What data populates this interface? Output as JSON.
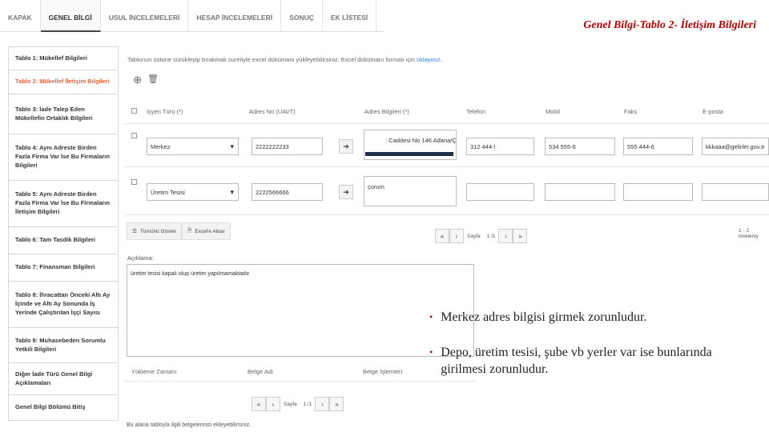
{
  "tabs": [
    {
      "label": "KAPAK"
    },
    {
      "label": "GENEL BİLGİ"
    },
    {
      "label": "USUL İNCELEMELERİ"
    },
    {
      "label": "HESAP İNCELEMELERİ"
    },
    {
      "label": "SONUÇ"
    },
    {
      "label": "EK LİSTESİ"
    }
  ],
  "slide_title": "Genel Bilgi-Tablo 2- İletişim Bilgileri",
  "sidebar": {
    "items": [
      {
        "label": "Tablo 1: Mükellef Bilgileri"
      },
      {
        "label": "Tablo 2: Mükellef İletişim Bilgileri"
      },
      {
        "label": "Tablo 3: İade Talep Eden Mükellefin Ortaklık Bilgileri"
      },
      {
        "label": "Tablo 4: Aynı Adreste Birden Fazla Firma Var İse Bu Firmaların Bilgileri"
      },
      {
        "label": "Tablo 5: Aynı Adreste Birden Fazla Firma Var İse Bu Firmaların İletişim Bilgileri"
      },
      {
        "label": "Tablo 6: Tam Tasdik Bilgileri"
      },
      {
        "label": "Tablo 7: Finansman Bilgileri"
      },
      {
        "label": "Tablo 8: İhracattan Önceki Altı Ay İçinde ve Altı Ay Sonunda İş Yerinde Çalıştırılan İşçi Sayısı"
      },
      {
        "label": "Tablo 9: Muhasebeden Sorumlu Yetkili Bilgileri"
      },
      {
        "label": "Diğer İade Türü Genel Bilgi Açıklamaları"
      },
      {
        "label": "Genel Bilgi Bölümü Bitiş"
      }
    ]
  },
  "hint": {
    "text": "Tablonun üstüne sürükleyip bırakmak suretiyle excel dokümanı yükleyebilirsiniz. Excel dokümanı formatı için",
    "link": "tıklayınız."
  },
  "columns": [
    "İşyeri Türü (*)",
    "Adres No (UAVT)",
    "Adres Bilgileri (*)",
    "Telefon",
    "Mobil",
    "Faks",
    "E-posta"
  ],
  "rows": [
    {
      "type": "Merkez",
      "uavt": "2222222233",
      "address": ": Caddesi No 146 Adana/Ç",
      "phone": "312 444-!",
      "mobile": "534 555-6",
      "fax": "555 444-6",
      "email": "kkkaaa@gelirler.gov.tr"
    },
    {
      "type": "Üretim Tesisi",
      "uavt": "2222566666",
      "address": "çorum",
      "phone": "",
      "mobile": "",
      "fax": "",
      "email": ""
    }
  ],
  "toolbar": {
    "show_all": "Tümünü Göster",
    "excel": "Excel'e Aktar",
    "list_info": "1 - 2 listeleniy"
  },
  "pager1": {
    "label": "Sayfa",
    "value": "1 /1"
  },
  "description": {
    "label": "Açıklama:",
    "value": "üretim tesisi kapalı olup üretim yapılmamaktadır."
  },
  "docs": {
    "columns": [
      "Yükleme Zamanı",
      "Belge Adı",
      "Belge İşlemleri"
    ]
  },
  "pager2": {
    "label": "Sayfa",
    "value": "1 /1"
  },
  "footer_hint": "Bu alana tabloyla ilgili belgelerinizi ekleyebilirsiniz.",
  "bullets": [
    "Merkez adres  bilgisi girmek zorunludur.",
    "Depo, üretim tesisi, şube vb yerler var ise bunlarında girilmesi zorunludur."
  ],
  "colors": {
    "accent": "#e8643c",
    "title": "#c00000",
    "link": "#3a7bd5"
  }
}
